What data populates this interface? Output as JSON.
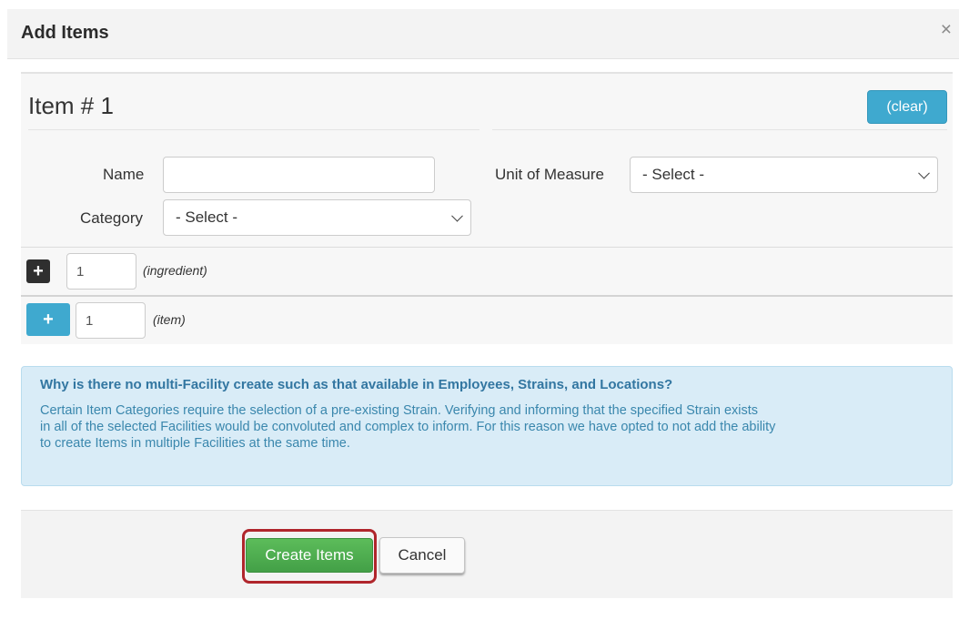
{
  "modal": {
    "title": "Add Items",
    "close_glyph": "×"
  },
  "item": {
    "heading": "Item # 1",
    "clear_label": "(clear)",
    "name_label": "Name",
    "name_value": "",
    "category_label": "Category",
    "category_selected": "- Select -",
    "unit_label": "Unit of Measure",
    "unit_selected": "- Select -"
  },
  "ingredient_row": {
    "add_icon": "plus-icon",
    "quantity": "1",
    "label": "(ingredient)"
  },
  "item_row": {
    "add_icon": "plus-icon",
    "quantity": "1",
    "label": "(item)"
  },
  "info": {
    "title": "Why is there no multi-Facility create such as that available in Employees, Strains, and Locations?",
    "body_lines": [
      "Certain Item Categories require the selection of a pre-existing Strain. Verifying and informing that the specified Strain exists",
      "in all of the selected Facilities would be convoluted and complex to inform. For this reason we have opted to not add the ability",
      "to create Items in multiple Facilities at the same time."
    ]
  },
  "footer": {
    "create_label": "Create Items",
    "cancel_label": "Cancel"
  },
  "colors": {
    "accent_blue": "#3fa9cf",
    "success_green": "#4caf50",
    "highlight_red": "#b0262c",
    "info_bg": "#d9ecf7"
  }
}
